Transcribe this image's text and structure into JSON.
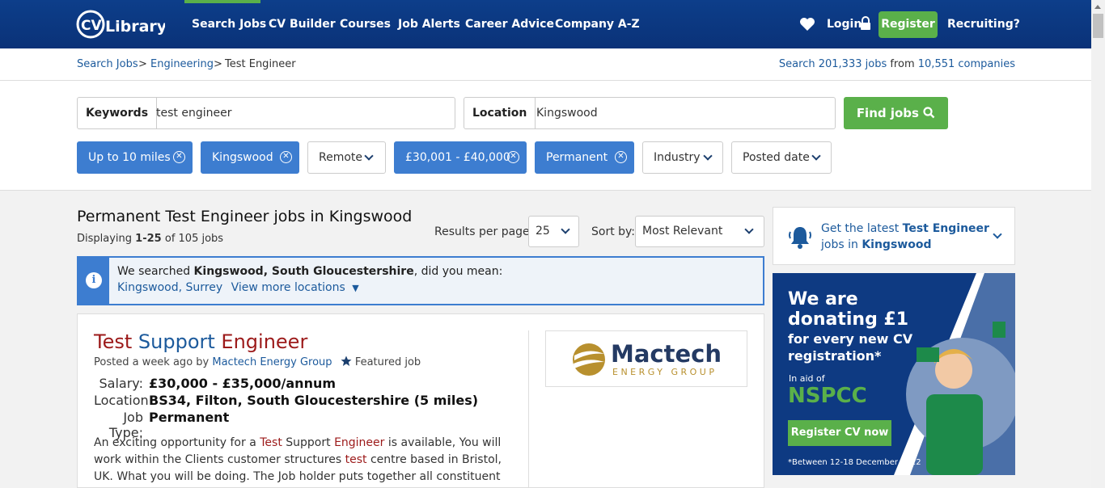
{
  "brand": {
    "logo_text": "CVLibrary",
    "primary": "#0d3e8a",
    "accent_green": "#5ab04a",
    "chip_blue": "#3d7dd0",
    "title_red": "#9c1a1a"
  },
  "nav": {
    "items": [
      "Search Jobs",
      "CV Builder",
      "Courses",
      "Job Alerts",
      "Career Advice",
      "Company A-Z"
    ],
    "login": "Login",
    "register": "Register",
    "recruiting": "Recruiting?"
  },
  "breadcrumb": {
    "items": [
      "Search Jobs",
      "Engineering",
      "Test Engineer"
    ],
    "separator": ">",
    "stats_prefix": "Search",
    "jobs_count": "201,333 jobs",
    "stats_middle": "from",
    "companies_count": "10,551 companies"
  },
  "search": {
    "keywords_label": "Keywords",
    "keywords_value": "test engineer",
    "location_label": "Location",
    "location_value": "Kingswood",
    "find_button": "Find jobs"
  },
  "filters": {
    "distance": "Up to 10 miles",
    "location": "Kingswood",
    "remote": "Remote",
    "salary": "£30,001 - £40,000",
    "job_type": "Permanent",
    "industry": "Industry",
    "posted_date": "Posted date"
  },
  "results": {
    "title": "Permanent Test Engineer jobs in Kingswood",
    "displaying_prefix": "Displaying",
    "displaying_range": "1-25",
    "displaying_suffix": "of 105 jobs",
    "per_page_label": "Results per page:",
    "per_page_value": "25",
    "sort_label": "Sort by:",
    "sort_value": "Most Relevant"
  },
  "did_you_mean": {
    "prefix": "We searched",
    "searched": "Kingswood, South Gloucestershire",
    "suffix": ", did you mean:",
    "suggestion": "Kingswood, Surrey",
    "more": "View more locations"
  },
  "job": {
    "title_part1": "Test",
    "title_part2": "Support",
    "title_part3": "Engineer",
    "posted_prefix": "Posted a week ago by",
    "company": "Mactech Energy Group",
    "featured": "Featured job",
    "salary_label": "Salary:",
    "salary_value": "£30,000 - £35,000/annum",
    "location_label": "Location:",
    "location_value": "BS34, Filton, South Gloucestershire (5 miles)",
    "type_label": "Job Type:",
    "type_value": "Permanent",
    "desc_1": "An exciting opportunity for a",
    "desc_hl1": "Test",
    "desc_2": "Support",
    "desc_hl2": "Engineer",
    "desc_3": "is available, You will work within the Clients customer structures",
    "desc_hl3": "test",
    "desc_4": "centre based in Bristol, UK. What you will be doing. The Job holder puts together all constituent elements of the",
    "logo_name": "Mactech",
    "logo_sub": "ENERGY GROUP"
  },
  "alert": {
    "prefix": "Get the latest",
    "keyword": "Test Engineer",
    "middle": "jobs in",
    "location": "Kingswood"
  },
  "ad": {
    "headline_1": "We are",
    "headline_2": "donating £1",
    "sub_1": "for every new CV",
    "sub_2": "registration*",
    "aid": "In aid of",
    "charity": "NSPCC",
    "button": "Register CV now",
    "footnote": "*Between 12-18 December 2022"
  }
}
